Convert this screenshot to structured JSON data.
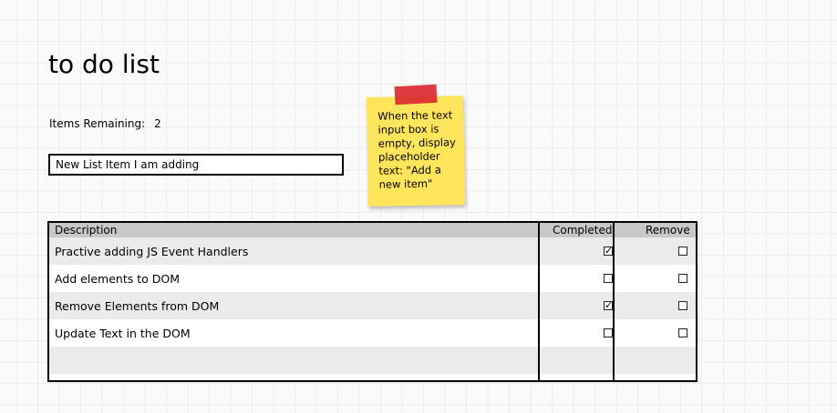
{
  "title": "to do list",
  "items_remaining": {
    "label": "Items Remaining:",
    "value": "2"
  },
  "input": {
    "value": "New List Item I am adding"
  },
  "note": {
    "text": "When the text input box is empty, display placeholder text: \"Add a new item\"",
    "color": "#ffe55c",
    "tape_color": "#d9262b"
  },
  "table": {
    "headers": {
      "description": "Description",
      "completed": "Completed",
      "remove": "Remove"
    },
    "rows": [
      {
        "description": "Practive adding JS Event Handlers",
        "completed": true,
        "remove": false
      },
      {
        "description": "Add elements to DOM",
        "completed": false,
        "remove": false
      },
      {
        "description": "Remove Elements from DOM",
        "completed": true,
        "remove": false
      },
      {
        "description": "Update Text in the DOM",
        "completed": false,
        "remove": false
      }
    ]
  }
}
